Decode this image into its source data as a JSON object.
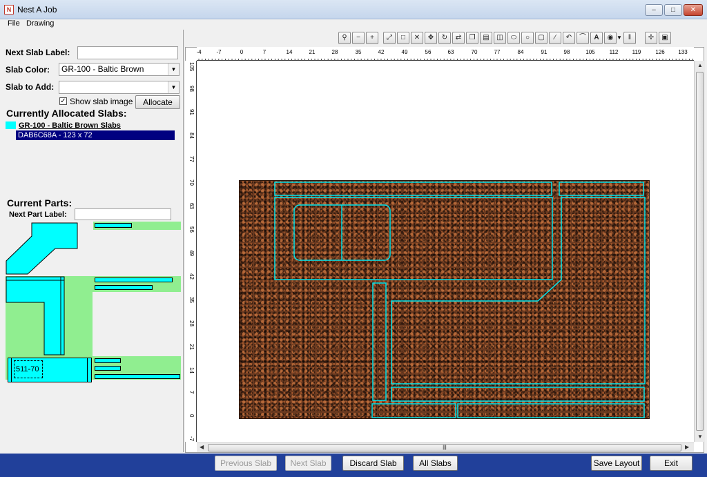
{
  "window": {
    "title": "Nest A Job",
    "icon_text": "N"
  },
  "menu": {
    "items": [
      "File",
      "Drawing"
    ]
  },
  "form": {
    "next_slab_label": "Next Slab Label:",
    "next_slab_value": "",
    "slab_color_label": "Slab Color:",
    "slab_color_value": "GR-100 - Baltic Brown",
    "slab_to_add_label": "Slab to Add:",
    "slab_to_add_value": "",
    "show_slab_image_label": "Show slab image",
    "show_slab_image_checked": true,
    "allocate_button": "Allocate"
  },
  "allocated": {
    "title": "Currently Allocated Slabs:",
    "group_label": "GR-100 - Baltic Brown  Slabs",
    "group_color": "#00ffff",
    "slabs": [
      "DAB6C68A - 123 x 72"
    ]
  },
  "parts": {
    "title": "Current Parts:",
    "next_part_label": "Next Part Label:",
    "next_part_value": "",
    "part_tag": "511-70"
  },
  "toolbar": {
    "icons": [
      "zoom-fit-icon",
      "zoom-out-icon",
      "zoom-in-icon",
      "select-all-icon",
      "select-rect-icon",
      "deselect-icon",
      "move-icon",
      "rotate-icon",
      "flip-icon",
      "copy-icon",
      "paste-icon",
      "group-icon",
      "ellipse-icon",
      "circle-icon",
      "rectangle-icon",
      "line-icon",
      "undo-curve-icon",
      "arc-icon",
      "text-icon",
      "layers-icon",
      "dropdown-arrow-icon",
      "dimension-icon",
      "snap-icon",
      "frame-icon"
    ]
  },
  "ruler": {
    "top_ticks": [
      "-4",
      "-7",
      "0",
      "7",
      "14",
      "21",
      "28",
      "35",
      "42",
      "49",
      "56",
      "63",
      "70",
      "77",
      "84",
      "91",
      "98",
      "105",
      "112",
      "119",
      "126",
      "133"
    ],
    "left_ticks": [
      "105",
      "98",
      "91",
      "84",
      "77",
      "70",
      "63",
      "56",
      "49",
      "42",
      "35",
      "28",
      "21",
      "14",
      "7",
      "0",
      "-7"
    ]
  },
  "buttons": {
    "previous_slab": "Previous Slab",
    "next_slab": "Next Slab",
    "discard_slab": "Discard Slab",
    "all_slabs": "All Slabs",
    "save_layout": "Save Layout",
    "exit": "Exit"
  },
  "colors": {
    "accent": "#21409a",
    "outline": "#00e5ee",
    "part_fill": "#00ffff",
    "part_bg": "#90ee90",
    "selection": "#000080"
  }
}
